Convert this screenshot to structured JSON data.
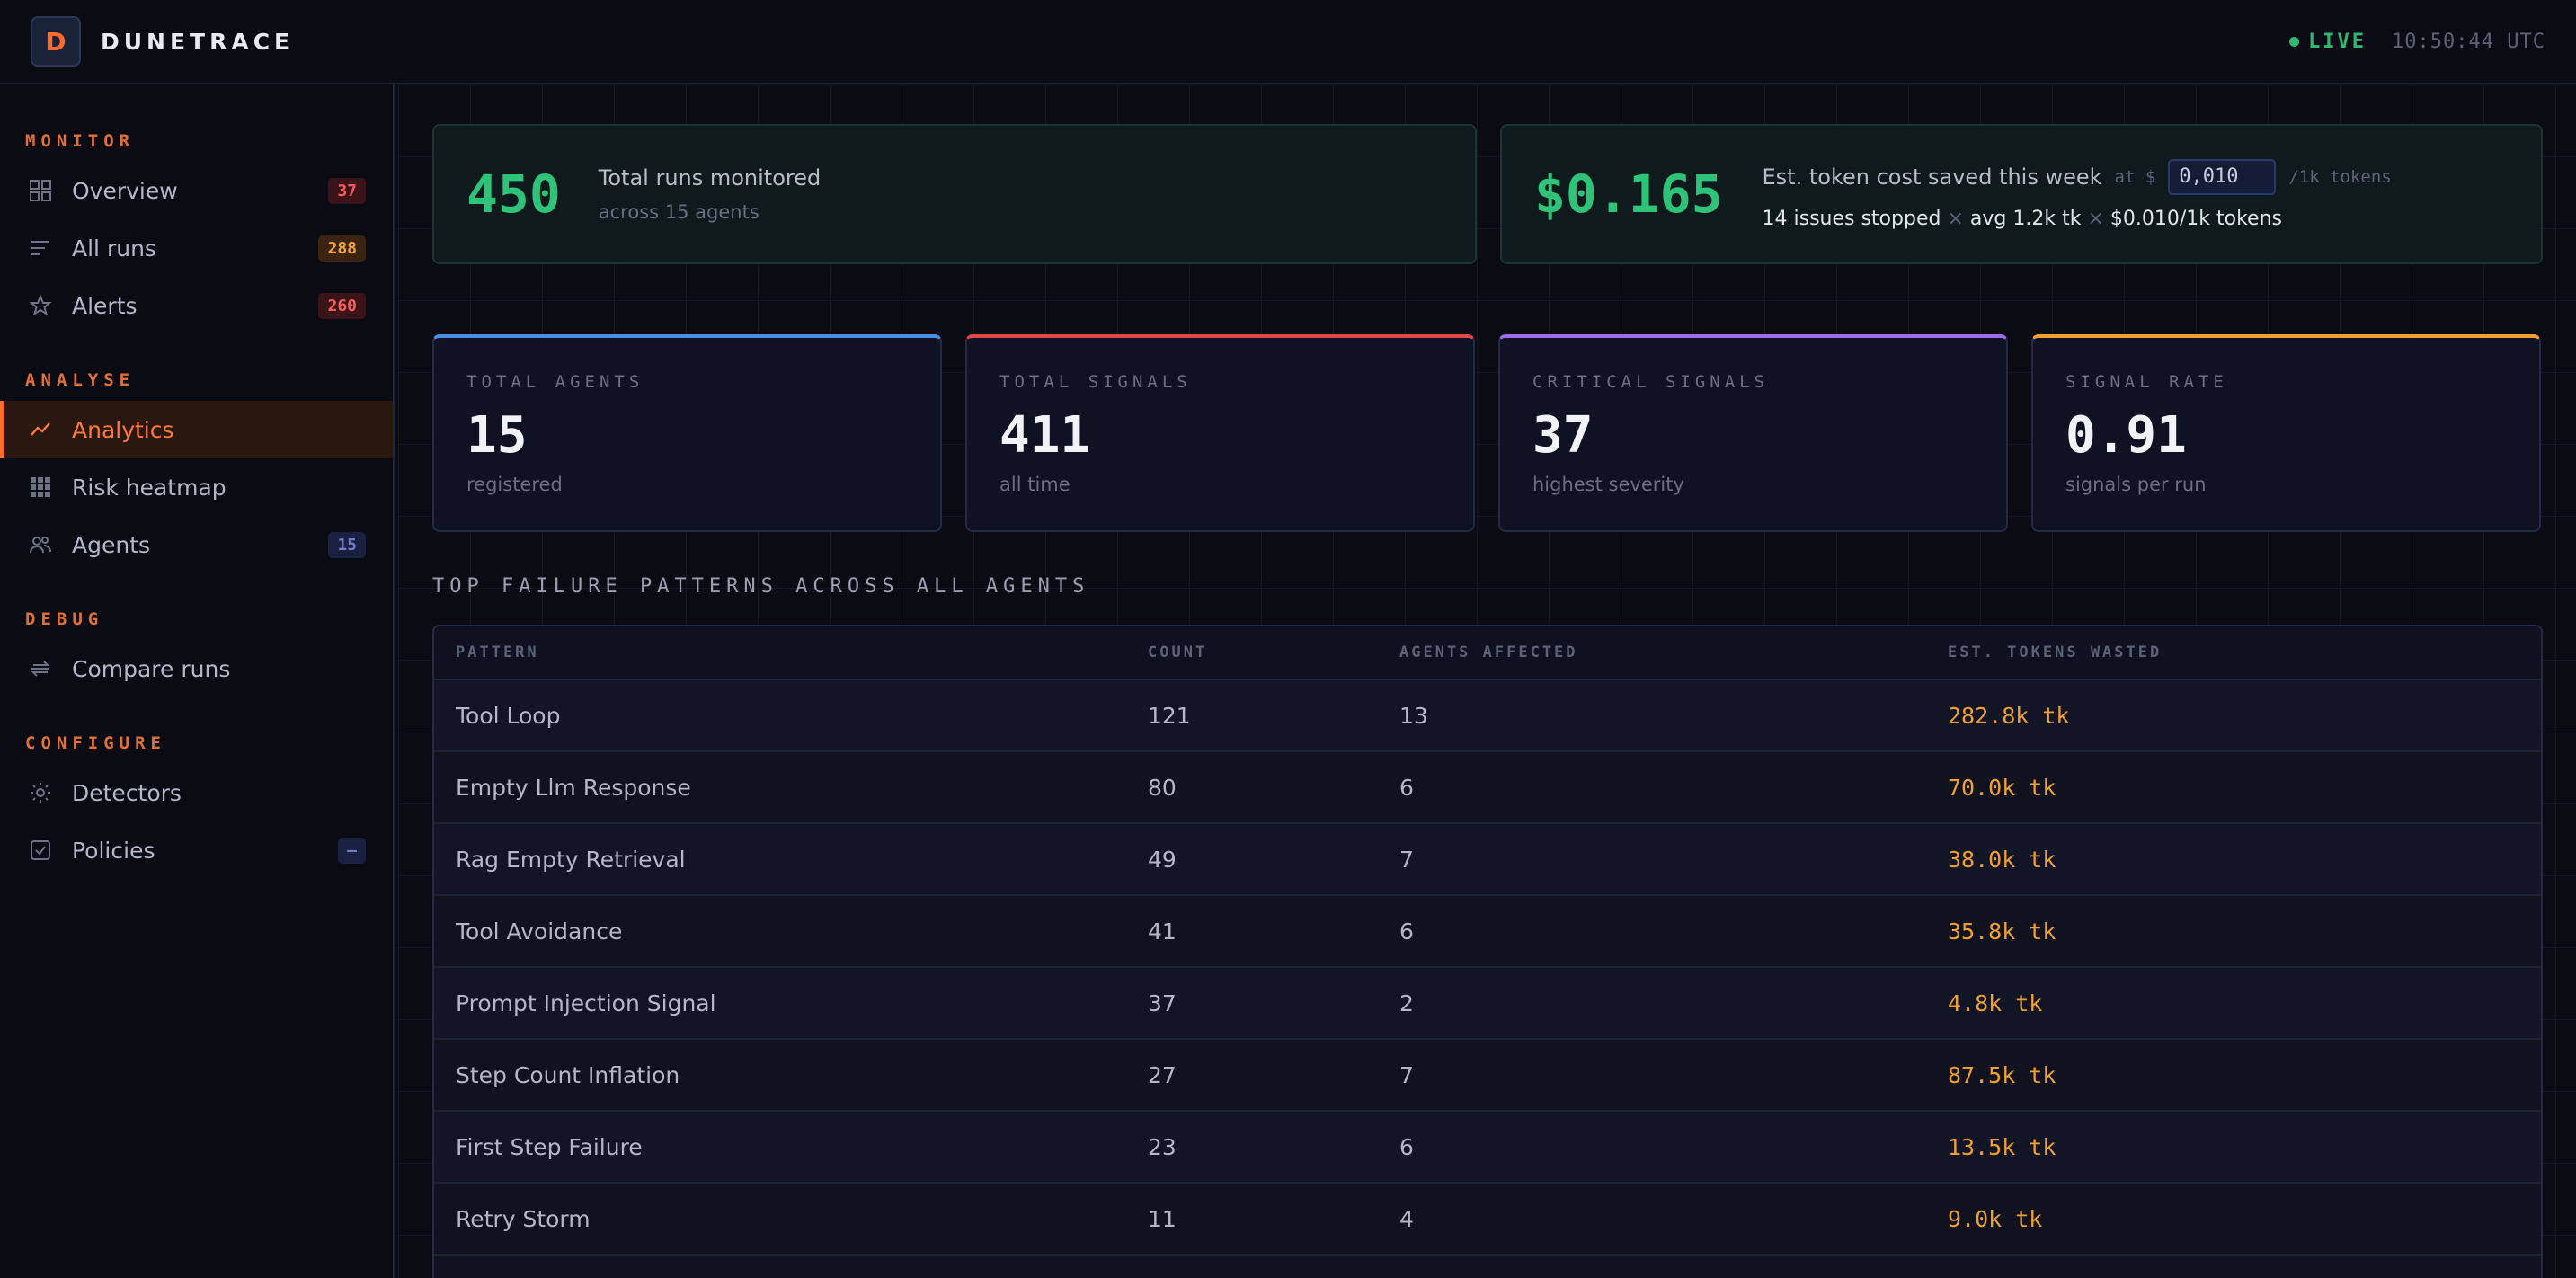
{
  "header": {
    "logo_letter": "D",
    "brand": "DUNETRACE",
    "live_label": "LIVE",
    "clock": "10:50:44 UTC"
  },
  "sidebar": {
    "sections": [
      {
        "title": "MONITOR",
        "items": [
          {
            "label": "Overview",
            "icon": "grid-icon",
            "badge": "37",
            "badge_style": "red"
          },
          {
            "label": "All runs",
            "icon": "list-icon",
            "badge": "288",
            "badge_style": "orange"
          },
          {
            "label": "Alerts",
            "icon": "star-icon",
            "badge": "260",
            "badge_style": "red"
          }
        ]
      },
      {
        "title": "ANALYSE",
        "items": [
          {
            "label": "Analytics",
            "icon": "trend-icon",
            "active": true
          },
          {
            "label": "Risk heatmap",
            "icon": "heatmap-icon"
          },
          {
            "label": "Agents",
            "icon": "users-icon",
            "badge": "15",
            "badge_style": "blue"
          }
        ]
      },
      {
        "title": "DEBUG",
        "items": [
          {
            "label": "Compare runs",
            "icon": "compare-icon"
          }
        ]
      },
      {
        "title": "CONFIGURE",
        "items": [
          {
            "label": "Detectors",
            "icon": "gear-icon"
          },
          {
            "label": "Policies",
            "icon": "checkbox-icon",
            "badge": "—",
            "badge_style": "blue"
          }
        ]
      }
    ]
  },
  "summary": {
    "runs": {
      "value": "450",
      "main": "Total runs monitored",
      "sub": "across 15 agents"
    },
    "cost": {
      "value": "$0.165",
      "main": "Est. token cost saved this week",
      "at_label": "at $",
      "rate_value": "0,010",
      "unit_label": "/1k tokens",
      "detail_a": "14 issues stopped",
      "detail_b": "avg 1.2k tk",
      "detail_c": "$0.010/1k tokens",
      "sep": "×"
    }
  },
  "stats": [
    {
      "label": "TOTAL AGENTS",
      "value": "15",
      "sub": "registered",
      "color": "#4a90e2"
    },
    {
      "label": "TOTAL SIGNALS",
      "value": "411",
      "sub": "all time",
      "color": "#e04848"
    },
    {
      "label": "CRITICAL SIGNALS",
      "value": "37",
      "sub": "highest severity",
      "color": "#9b6ee8"
    },
    {
      "label": "SIGNAL RATE",
      "value": "0.91",
      "sub": "signals per run",
      "color": "#f0a030"
    }
  ],
  "patterns": {
    "title": "TOP FAILURE PATTERNS ACROSS ALL AGENTS",
    "columns": [
      "PATTERN",
      "COUNT",
      "AGENTS AFFECTED",
      "EST. TOKENS WASTED"
    ],
    "rows": [
      [
        "Tool Loop",
        "121",
        "13",
        "282.8k tk"
      ],
      [
        "Empty Llm Response",
        "80",
        "6",
        "70.0k tk"
      ],
      [
        "Rag Empty Retrieval",
        "49",
        "7",
        "38.0k tk"
      ],
      [
        "Tool Avoidance",
        "41",
        "6",
        "35.8k tk"
      ],
      [
        "Prompt Injection Signal",
        "37",
        "2",
        "4.8k tk"
      ],
      [
        "Step Count Inflation",
        "27",
        "7",
        "87.5k tk"
      ],
      [
        "First Step Failure",
        "23",
        "6",
        "13.5k tk"
      ],
      [
        "Retry Storm",
        "11",
        "4",
        "9.0k tk"
      ]
    ]
  }
}
